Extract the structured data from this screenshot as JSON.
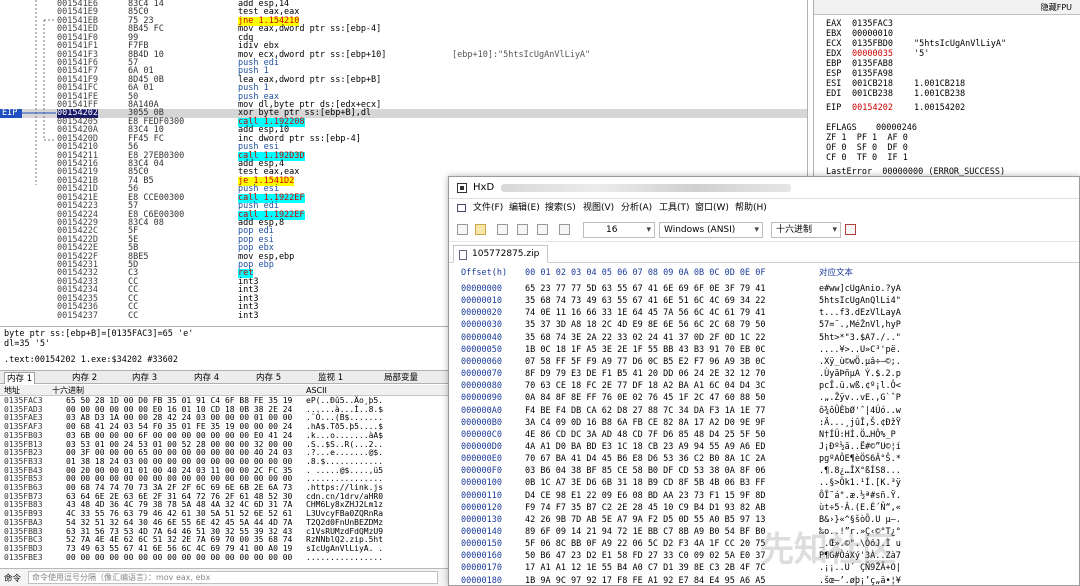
{
  "disasm": {
    "eip_label": "EIP",
    "rows": [
      {
        "addr": "001541E6",
        "bytes": "83C4 14",
        "instr": "add esp,14",
        "cmt": "",
        "style": "",
        "sel": false
      },
      {
        "addr": "001541E9",
        "bytes": "85C0",
        "instr": "test eax,eax",
        "cmt": "",
        "style": "",
        "sel": false
      },
      {
        "addr": "001541EB",
        "bytes": "75 23",
        "instr": "jne 1.154210",
        "cmt": "",
        "style": "yellow",
        "sel": false
      },
      {
        "addr": "001541ED",
        "bytes": "8B45 FC",
        "instr": "mov eax,dword ptr ss:[ebp-4]",
        "cmt": "",
        "style": "",
        "sel": false
      },
      {
        "addr": "001541F0",
        "bytes": "99",
        "instr": "cdq",
        "cmt": "",
        "style": "",
        "sel": false
      },
      {
        "addr": "001541F1",
        "bytes": "F7FB",
        "instr": "idiv ebx",
        "cmt": "",
        "style": "",
        "sel": false
      },
      {
        "addr": "001541F3",
        "bytes": "8B4D 10",
        "instr": "mov ecx,dword ptr ss:[ebp+10]",
        "cmt": "[ebp+10]:\"5htsIcUgAnVlLiyA\"",
        "style": "",
        "sel": false
      },
      {
        "addr": "001541F6",
        "bytes": "57",
        "instr": "push edi",
        "cmt": "",
        "style": "push",
        "sel": false
      },
      {
        "addr": "001541F7",
        "bytes": "6A 01",
        "instr": "push 1",
        "cmt": "",
        "style": "push",
        "sel": false
      },
      {
        "addr": "001541F9",
        "bytes": "8D45 0B",
        "instr": "lea eax,dword ptr ss:[ebp+B]",
        "cmt": "",
        "style": "",
        "sel": false
      },
      {
        "addr": "001541FC",
        "bytes": "6A 01",
        "instr": "push 1",
        "cmt": "",
        "style": "push",
        "sel": false
      },
      {
        "addr": "001541FE",
        "bytes": "50",
        "instr": "push eax",
        "cmt": "",
        "style": "push",
        "sel": false
      },
      {
        "addr": "001541FF",
        "bytes": "8A140A",
        "instr": "mov dl,byte ptr ds:[edx+ecx]",
        "cmt": "",
        "style": "",
        "sel": false
      },
      {
        "addr": "00154202",
        "bytes": "3055 0B",
        "instr": "xor byte ptr ss:[ebp+B],dl",
        "cmt": "",
        "style": "",
        "sel": true
      },
      {
        "addr": "00154205",
        "bytes": "E8 FEDF0300",
        "instr": "call 1.192208",
        "cmt": "",
        "style": "cyan",
        "sel": false
      },
      {
        "addr": "0015420A",
        "bytes": "83C4 10",
        "instr": "add esp,10",
        "cmt": "",
        "style": "",
        "sel": false
      },
      {
        "addr": "0015420D",
        "bytes": "FF45 FC",
        "instr": "inc dword ptr ss:[ebp-4]",
        "cmt": "",
        "style": "",
        "sel": false
      },
      {
        "addr": "00154210",
        "bytes": "56",
        "instr": "push esi",
        "cmt": "",
        "style": "push",
        "sel": false
      },
      {
        "addr": "00154211",
        "bytes": "E8 27EB0300",
        "instr": "call 1.192D3D",
        "cmt": "",
        "style": "cyan",
        "sel": false
      },
      {
        "addr": "00154216",
        "bytes": "83C4 04",
        "instr": "add esp,4",
        "cmt": "",
        "style": "",
        "sel": false
      },
      {
        "addr": "00154219",
        "bytes": "85C0",
        "instr": "test eax,eax",
        "cmt": "",
        "style": "",
        "sel": false
      },
      {
        "addr": "0015421B",
        "bytes": "74 B5",
        "instr": "je 1.1541D2",
        "cmt": "",
        "style": "yellow",
        "sel": false
      },
      {
        "addr": "0015421D",
        "bytes": "56",
        "instr": "push esi",
        "cmt": "",
        "style": "push",
        "sel": false
      },
      {
        "addr": "0015421E",
        "bytes": "E8 CCE00300",
        "instr": "call 1.1922EF",
        "cmt": "",
        "style": "cyan",
        "sel": false
      },
      {
        "addr": "00154223",
        "bytes": "57",
        "instr": "push edi",
        "cmt": "",
        "style": "push",
        "sel": false
      },
      {
        "addr": "00154224",
        "bytes": "E8 C6E00300",
        "instr": "call 1.1922EF",
        "cmt": "",
        "style": "cyan",
        "sel": false
      },
      {
        "addr": "00154229",
        "bytes": "83C4 08",
        "instr": "add esp,8",
        "cmt": "",
        "style": "",
        "sel": false
      },
      {
        "addr": "0015422C",
        "bytes": "5F",
        "instr": "pop edi",
        "cmt": "",
        "style": "pop",
        "sel": false
      },
      {
        "addr": "0015422D",
        "bytes": "5E",
        "instr": "pop esi",
        "cmt": "",
        "style": "pop",
        "sel": false
      },
      {
        "addr": "0015422E",
        "bytes": "5B",
        "instr": "pop ebx",
        "cmt": "",
        "style": "pop",
        "sel": false
      },
      {
        "addr": "0015422F",
        "bytes": "8BE5",
        "instr": "mov esp,ebp",
        "cmt": "",
        "style": "",
        "sel": false
      },
      {
        "addr": "00154231",
        "bytes": "5D",
        "instr": "pop ebp",
        "cmt": "",
        "style": "pop",
        "sel": false
      },
      {
        "addr": "00154232",
        "bytes": "C3",
        "instr": "ret",
        "cmt": "",
        "style": "cyan",
        "sel": false
      },
      {
        "addr": "00154233",
        "bytes": "CC",
        "instr": "int3",
        "cmt": "",
        "style": "",
        "sel": false
      },
      {
        "addr": "00154234",
        "bytes": "CC",
        "instr": "int3",
        "cmt": "",
        "style": "",
        "sel": false
      },
      {
        "addr": "00154235",
        "bytes": "CC",
        "instr": "int3",
        "cmt": "",
        "style": "",
        "sel": false
      },
      {
        "addr": "00154236",
        "bytes": "CC",
        "instr": "int3",
        "cmt": "",
        "style": "",
        "sel": false
      },
      {
        "addr": "00154237",
        "bytes": "CC",
        "instr": "int3",
        "cmt": "",
        "style": "",
        "sel": false
      }
    ]
  },
  "registers": {
    "header": "隐藏FPU",
    "rows": [
      {
        "name": "EAX",
        "value": "0135FAC3",
        "extra": "",
        "red": false
      },
      {
        "name": "EBX",
        "value": "00000010",
        "extra": "",
        "red": false
      },
      {
        "name": "ECX",
        "value": "0135FBD0",
        "extra": "\"5htsIcUgAnVlLiyA\"",
        "red": false
      },
      {
        "name": "EDX",
        "value": "00000035",
        "extra": "'5'",
        "red": true
      },
      {
        "name": "EBP",
        "value": "0135FAB8",
        "extra": "",
        "red": false
      },
      {
        "name": "ESP",
        "value": "0135FA98",
        "extra": "",
        "red": false
      },
      {
        "name": "ESI",
        "value": "001CB218",
        "extra": "1.001CB218",
        "red": false
      },
      {
        "name": "EDI",
        "value": "001CB238",
        "extra": "1.001CB238",
        "red": false
      },
      {
        "name": "EIP",
        "value": "00154202",
        "extra": "1.00154202",
        "red": true
      }
    ],
    "eflags_label": "EFLAGS",
    "eflags_value": "00000246",
    "flags": [
      "ZF 1  PF 1  AF 0",
      "OF 0  SF 0  DF 0",
      "CF 0  TF 0  IF 1"
    ],
    "lasterror": "LastError  00000000 (ERROR_SUCCESS)"
  },
  "info": {
    "line1": "byte ptr ss:[ebp+B]=[0135FAC3]=65 'e'",
    "line2": "dl=35 '5'",
    "line3": ".text:00154202 1.exe:$34202 #33602"
  },
  "memtabs": [
    "内存 1",
    "内存 2",
    "内存 3",
    "内存 4",
    "内存 5",
    "监视 1",
    "局部变量"
  ],
  "dump": {
    "head_addr": "地址",
    "head_hex": "十六进制",
    "head_ascii": "ASCII",
    "rows": [
      {
        "a": "0135FAC3",
        "h": "65 50 28 1D 00 D0 FB 35 01 91 C4 6F B8 FE 35 19",
        "s": "eP(..Ðû5..Äo¸þ5."
      },
      {
        "a": "0135FAD3",
        "h": "00 00 00 00 00 00 E0 16 01 10 CD 18 0B 38 2E 24",
        "s": "......à...Í..8.$"
      },
      {
        "a": "0135FAE3",
        "h": "03 A8 D3 1A 00 00 28 42 24 03 00 00 00 01 00 00",
        "s": ".¨Ó...(B$......."
      },
      {
        "a": "0135FAF3",
        "h": "00 68 41 24 03 54 F0 35 01 FE 35 19 00 00 00 24",
        "s": ".hA$.Tð5.þ5....$"
      },
      {
        "a": "0135FB03",
        "h": "03 6B 00 00 00 6F 00 00 00 00 00 00 00 E0 41 24",
        "s": ".k...o.......àA$"
      },
      {
        "a": "0135FB13",
        "h": "03 53 01 00 24 53 01 00 52 28 00 00 00 32 00 00",
        "s": ".S..$S..R(...2.."
      },
      {
        "a": "0135FB23",
        "h": "00 3F 00 00 00 65 00 00 00 00 00 00 00 40 24 03",
        "s": ".?...e.......@$."
      },
      {
        "a": "0135FB33",
        "h": "01 38 18 24 03 00 00 00 00 00 00 00 00 00 00 00",
        "s": ".8.$............"
      },
      {
        "a": "0135FB43",
        "h": "00 20 00 00 01 01 00 40 24 03 11 00 00 2C FC 35",
        "s": ". .....@$....,ü5"
      },
      {
        "a": "0135FB53",
        "h": "00 00 00 00 00 00 00 00 00 00 00 00 00 00 00 00",
        "s": "................"
      },
      {
        "a": "0135FB63",
        "h": "00 68 74 74 70 73 3A 2F 2F 6C 69 6E 6B 2E 6A 73",
        "s": ".https://link.js"
      },
      {
        "a": "0135FB73",
        "h": "63 64 6E 2E 63 6E 2F 31 64 72 76 2F 61 48 52 30",
        "s": "cdn.cn/1drv/aHR0"
      },
      {
        "a": "0135FB83",
        "h": "43 48 4D 36 4C 79 38 78 5A 48 4A 32 4C 6D 31 7A",
        "s": "CHM6Ly8xZHJ2Lm1z"
      },
      {
        "a": "0135FB93",
        "h": "4C 33 55 76 63 79 46 42 61 30 5A 51 52 6E 52 61",
        "s": "L3UvcyFBa0ZQRnRa"
      },
      {
        "a": "0135FBA3",
        "h": "54 32 51 32 64 30 46 6E 55 6E 42 45 5A 44 4D 7A",
        "s": "T2Q2d0FnUnBEZDMz"
      },
      {
        "a": "0135FBB3",
        "h": "63 31 56 73 53 4D 7A 64 46 51 30 32 55 39 32 43",
        "s": "c1VsRUMzdFdQMzU9"
      },
      {
        "a": "0135FBC3",
        "h": "52 7A 4E 4E 62 6C 51 32 2E 7A 69 70 00 35 68 74",
        "s": "RzNNblQ2.zip.5ht"
      },
      {
        "a": "0135FBD3",
        "h": "73 49 63 55 67 41 6E 56 6C 4C 69 79 41 00 A0 19",
        "s": "sIcUgAnVlLiyA. ."
      },
      {
        "a": "0135FBE3",
        "h": "00 00 00 00 00 00 00 00 00 00 00 00 00 00 00 00",
        "s": "................"
      }
    ]
  },
  "cmdbar": {
    "label": "命令",
    "placeholder": "命令使用逗号分隔（像汇编语言）：mov eax, ebx"
  },
  "hxd": {
    "title": "HxD",
    "menu": [
      "文件(F)",
      "编辑(E)",
      "搜索(S)",
      "视图(V)",
      "分析(A)",
      "工具(T)",
      "窗口(W)",
      "帮助(H)"
    ],
    "toolbar": {
      "bytes_per_row": "16",
      "charset": "Windows (ANSI)",
      "offset_base": "十六进制"
    },
    "file_tab": "105772875.zip",
    "offset_head": "Offset(h)",
    "hex_head": "00 01 02 03 04 05 06 07 08 09 0A 0B 0C 0D 0E 0F",
    "text_head": "对应文本",
    "rows": [
      {
        "o": "00000000",
        "h": "65 23 77 77 5D 63 55 67 41 6E 69 6F 0E 3F 79 41",
        "t": "e#ww]cUgAnio.?yA"
      },
      {
        "o": "00000010",
        "h": "35 68 74 73 49 63 55 67 41 6E 51 6C 4C 69 34 22",
        "t": "5htsIcUgAnQlLi4\""
      },
      {
        "o": "00000020",
        "h": "74 0E 11 16 66 33 1E 64 45 7A 56 6C 4C 61 79 41",
        "t": "t...f3.dEzVlLayA"
      },
      {
        "o": "00000030",
        "h": "35 37 3D A8 18 2C 4D E9 8E 6E 56 6C 2C 68 79 50",
        "t": "57=¨.,MéŽnVl,hyP"
      },
      {
        "o": "00000040",
        "h": "35 68 74 3E 2A 22 33 02 24 41 37 0D 2F 0D 1C 22",
        "t": "5ht>*\"3.$A7./..\""
      },
      {
        "o": "00000050",
        "h": "1B 0C 18 1F A5 3E 2E 1F 55 BB 43 B3 91 70 EB 0C",
        "t": "....¥>..U»C³'pë."
      },
      {
        "o": "00000060",
        "h": "07 58 FF 5F F9 A9 77 D6 0C B5 E2 F7 96 A9 3B 0C",
        "t": ".Xÿ_ù©wÖ.µâ÷–©;."
      },
      {
        "o": "00000070",
        "h": "8F D9 79 E3 DE F1 B5 41 20 DD 06 24 2E 32 12 70",
        "t": ".ÙyãÞñµA Ý.$.2.p"
      },
      {
        "o": "00000080",
        "h": "70 63 CE 18 FC 2E 77 DF 18 A2 BA A1 6C 04 D4 3C",
        "t": "pcÎ.ü.wß.¢º¡l.Ô<"
      },
      {
        "o": "00000090",
        "h": "0A 84 8F 8E FF 76 0E 02 76 45 1F 2C 47 60 88 50",
        "t": ".„.Žÿv..vE.,G`ˆP"
      },
      {
        "o": "000000A0",
        "h": "F4 BE F4 DB CA 62 D8 27 88 7C 34 DA F3 1A 1E 77",
        "t": "ô¾ôÛÊbØ'ˆ|4Úó..w"
      },
      {
        "o": "000000B0",
        "h": "3A C4 09 0D 16 B8 6A FB CE 82 8A 17 A2 D0 9E 9F",
        "t": ":Ä...¸jûÎ‚Š.¢ÐžŸ"
      },
      {
        "o": "000000C0",
        "h": "4E 86 CD DC 3A AD 48 CD 7F D6 85 48 D4 25 5F 50",
        "t": "N†ÍÜ:­HÍ.Ö…HÔ%_P"
      },
      {
        "o": "000000D0",
        "h": "4A A1 D0 BA BD E3 1C 18 CB 23 A9 94 55 A9 A6 ED",
        "t": "J¡Ðº½ã..Ë#©”U©¦í"
      },
      {
        "o": "000000E0",
        "h": "70 67 BA 41 D4 45 B6 E8 D6 53 36 C2 B0 8A 1C 2A",
        "t": "pgºAÔE¶èÖS6Â°Š.*"
      },
      {
        "o": "000000F0",
        "h": "03 B6 04 38 BF 85 CE 58 B0 DF CD 53 38 0A 8F 06",
        "t": ".¶.8¿…ÎX°ßÍS8..."
      },
      {
        "o": "00000100",
        "h": "0B 1C A7 3E D6 6B 31 18 B9 CD 8F 5B 4B 06 B3 FF",
        "t": "..§>Ök1.¹Í.[K.³ÿ"
      },
      {
        "o": "00000110",
        "h": "D4 CE 98 E1 22 09 E6 08 BD AA 23 73 F1 15 9F 8D",
        "t": "ÔÎ˜á\".æ.½ª#sñ.Ÿ."
      },
      {
        "o": "00000120",
        "h": "F9 74 F7 35 B7 C2 2E 28 45 10 C9 B4 D1 93 82 AB",
        "t": "ùt÷5·Â.(E.É´Ñ“‚«"
      },
      {
        "o": "00000130",
        "h": "42 26 9B 7D AB 5E A7 9A F2 D5 0D 55 A0 B5 97 13",
        "t": "B&›}«^§šòÕ.U µ—."
      },
      {
        "o": "00000140",
        "h": "89 6F 09 14 21 94 72 1E BB C7 8B A9 B0 54 BF B0",
        "t": "‰o..!”r.»Ç‹©°T¿°"
      },
      {
        "o": "00000150",
        "h": "5F 06 8C BB 0F A9 22 06 5C D2 F3 4A 1F CC 20 75",
        "t": "_.Œ».©\".\\ÒóJ.Ì u"
      },
      {
        "o": "00000160",
        "h": "50 B6 47 23 D2 E1 58 FD 27 33 C0 09 02 5A E0 37",
        "t": "P¶G#ÒáXý'3À..Zà7"
      },
      {
        "o": "00000170",
        "h": "17 A1 A1 12 1E 55 B4 A0 C7 D1 39 8E C3 2B 4F 7C",
        "t": ".¡¡..U´ ÇÑ9ŽÃ+O|"
      },
      {
        "o": "00000180",
        "h": "1B 9A 9C 97 92 17 F8 FE A1 92 E7 84 E4 95 A6 A5",
        "t": ".šœ—’.øþ¡’ç„ä•¦¥"
      }
    ]
  },
  "watermark": "先知社区"
}
